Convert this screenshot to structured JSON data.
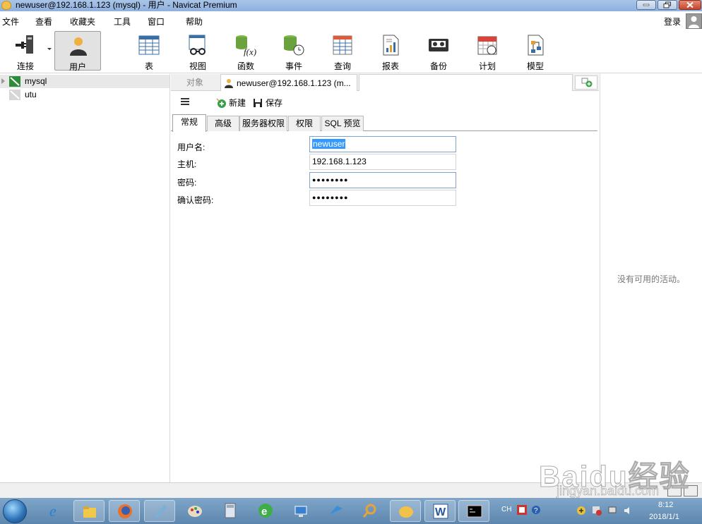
{
  "window": {
    "title": "newuser@192.168.1.123 (mysql) - 用户 - Navicat Premium"
  },
  "menu": {
    "items": [
      "文件",
      "查看",
      "收藏夹",
      "工具",
      "窗口",
      "帮助"
    ],
    "login": "登录"
  },
  "toolbar": {
    "connect": "连接",
    "user": "用户",
    "table": "表",
    "view": "视图",
    "function": "函数",
    "event": "事件",
    "query": "查询",
    "report": "报表",
    "backup": "备份",
    "schedule": "计划",
    "model": "模型"
  },
  "sidebar": {
    "items": [
      {
        "name": "mysql"
      },
      {
        "name": "utu"
      }
    ]
  },
  "tabs": {
    "objects": "对象",
    "user_tab": "newuser@192.168.1.123 (m..."
  },
  "actions": {
    "new": "新建",
    "save": "保存"
  },
  "form_tabs": [
    "常规",
    "高级",
    "服务器权限",
    "权限",
    "SQL 预览"
  ],
  "form": {
    "username_label": "用户名:",
    "username_value": "newuser",
    "host_label": "主机:",
    "host_value": "192.168.1.123",
    "password_label": "密码:",
    "password_value": "●●●●●●●●",
    "confirm_label": "确认密码:",
    "confirm_value": "●●●●●●●●"
  },
  "activity": {
    "message": "没有可用的活动。"
  },
  "taskbar": {
    "lang": "CH",
    "time": "8:12",
    "date": "2018/1/1"
  },
  "watermark": {
    "text": "Baidu经验",
    "sub": "jingyan.baidu.com"
  },
  "colors": {
    "selection": "#3399ff",
    "titlebar": "#a9c4e8",
    "taskbar": "#5d86ae"
  }
}
